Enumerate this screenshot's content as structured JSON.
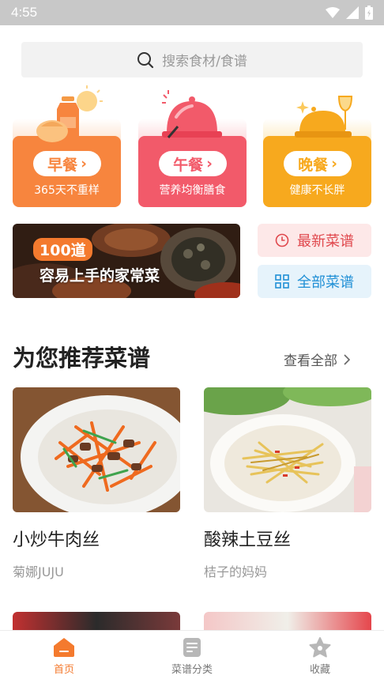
{
  "status_bar": {
    "time": "4:55"
  },
  "search": {
    "placeholder": "搜索食材/食谱"
  },
  "meals": [
    {
      "label": "早餐",
      "sub": "365天不重样",
      "color": "#f7853e",
      "light": "#fde3cf"
    },
    {
      "label": "午餐",
      "sub": "营养均衡膳食",
      "color": "#f25a6a",
      "light": "#fcd9dc"
    },
    {
      "label": "晚餐",
      "sub": "健康不长胖",
      "color": "#f7a91e",
      "light": "#fcebc4"
    }
  ],
  "banner": {
    "count": "100道",
    "title": "容易上手的家常菜"
  },
  "quick_links": {
    "latest": "最新菜谱",
    "all": "全部菜谱"
  },
  "recommend": {
    "title": "为您推荐菜谱",
    "more": "查看全部",
    "recipes": [
      {
        "name": "小炒牛肉丝",
        "author": "菊娜JUJU"
      },
      {
        "name": "酸辣土豆丝",
        "author": "桔子的妈妈"
      }
    ]
  },
  "tabs": [
    {
      "label": "首页",
      "icon": "home-icon",
      "active": true
    },
    {
      "label": "菜谱分类",
      "icon": "document-icon",
      "active": false
    },
    {
      "label": "收藏",
      "icon": "star-icon",
      "active": false
    }
  ],
  "colors": {
    "accent": "#f47a2e",
    "latest": "#e0484d",
    "all": "#2190d6"
  }
}
